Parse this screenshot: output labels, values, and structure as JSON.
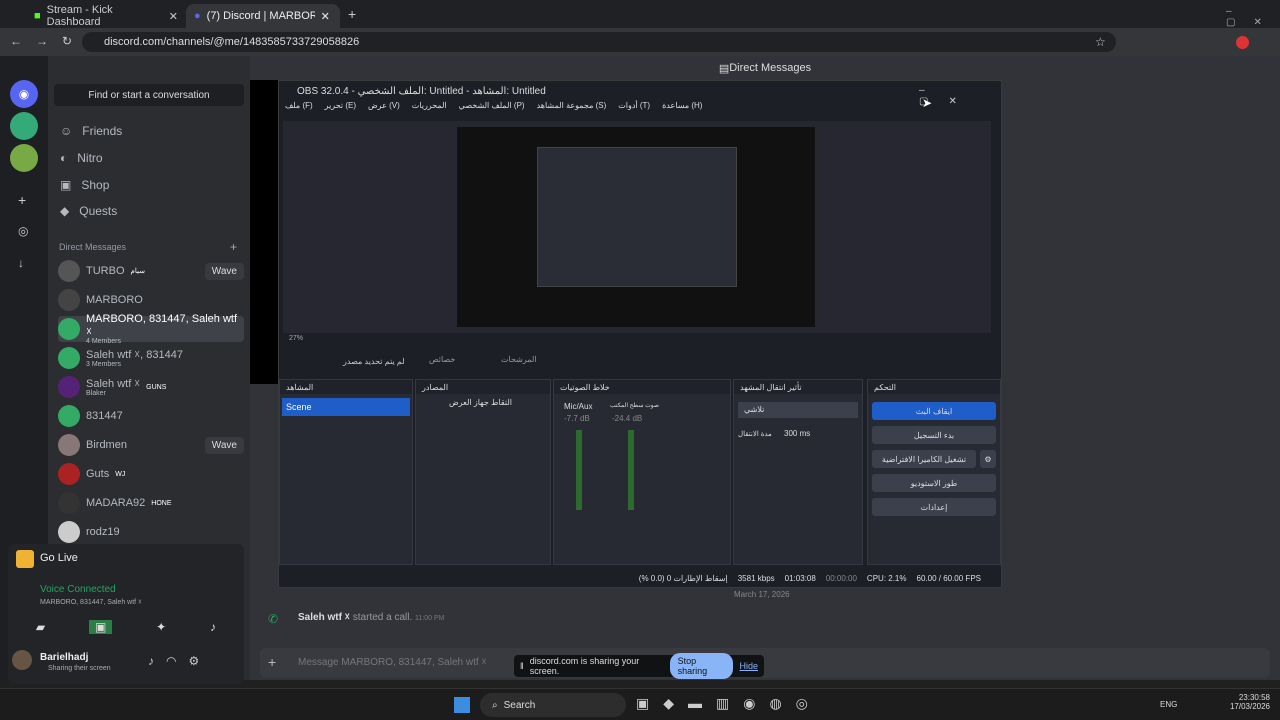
{
  "browser": {
    "tabs": [
      "Stream - Kick Dashboard",
      "(7) Discord | MARBORO, 831447, Saleh wtf"
    ],
    "url": "discord.com/channels/@me/1483585733729058826"
  },
  "discord": {
    "find": "Find or start a conversation",
    "nav": [
      "Friends",
      "Nitro",
      "Shop",
      "Quests"
    ],
    "dm_header": "Direct Messages",
    "dms": [
      {
        "name": "TURBO",
        "tag": "سيام",
        "wave": "Wave",
        "color": "#555"
      },
      {
        "name": "MARBORO",
        "color": "#444"
      },
      {
        "name": "MARBORO, 831447, Saleh wtf ☓",
        "sub": "4 Members",
        "color": "#3a6"
      },
      {
        "name": "Saleh wtf ☓, 831447",
        "sub": "3 Members",
        "color": "#3a6"
      },
      {
        "name": "Saleh wtf ☓",
        "tag": "GUNS",
        "sub": "Blaker",
        "color": "#527"
      },
      {
        "name": "831447",
        "color": "#3a6"
      },
      {
        "name": "Birdmen",
        "wave": "Wave",
        "color": "#877"
      },
      {
        "name": "Guts",
        "tag": "WJ",
        "color": "#a22"
      },
      {
        "name": "MADARA92",
        "tag": "HONE",
        "color": "#333"
      },
      {
        "name": "rodz19",
        "color": "#ccc"
      }
    ],
    "topbar": "Direct Messages",
    "golive": "Go Live",
    "voice": "Voice Connected",
    "voice_sub": "MARBORO, 831447, Saleh wtf ☓",
    "user": "Barielhadj",
    "user_status": "Sharing their screen",
    "date_sep": "March 17, 2026",
    "call_user": "Saleh wtf ☓",
    "call_text": "started a call.",
    "call_time": "11:00 PM",
    "placeholder": "Message MARBORO, 831447, Saleh wtf ☓",
    "share_text": "discord.com is sharing your screen.",
    "stop": "Stop sharing",
    "hide": "Hide"
  },
  "obs": {
    "title": "OBS 32.0.4 - الملف الشخصي: Untitled - المشاهد: Untitled",
    "menu": [
      "ملف (F)",
      "تحرير (E)",
      "عرض (V)",
      "المحرريات",
      "الملف الشخصي (P)",
      "مجموعة المشاهد (S)",
      "أدوات (T)",
      "مساعدة (H)"
    ],
    "zoom": "27%",
    "no_source": "لم يتم تحديد مصدر",
    "props": "خصائص",
    "filters": "المرشحات",
    "docks": {
      "scenes": "المشاهد",
      "sources": "المصادر",
      "mixer": "خلاط الصوتيات",
      "transitions": "تأثير انتقال المشهد",
      "controls": "التحكم"
    },
    "scene": "Scene",
    "source": "التقاط جهاز العرض",
    "mic": {
      "name": "Mic/Aux",
      "db": "-7.7 dB"
    },
    "desk": {
      "name": "صوت سطح المكتب",
      "db": "-24.4 dB"
    },
    "transition": "تلاشي",
    "duration_label": "مدة الانتقال",
    "duration": "300 ms",
    "controls": [
      "ايقاف البث",
      "بدء التسجيل",
      "تشغيل الكاميرا الافتراضية",
      "طور الاستوديو",
      "إعدادات"
    ],
    "status": {
      "dropped": "إسقاط الإطارات 0 (0.0 %)",
      "kbps": "3581 kbps",
      "time": "01:03:08",
      "rec": "00:00:00",
      "cpu": "CPU: 2.1%",
      "fps": "60.00 / 60.00 FPS"
    }
  },
  "taskbar": {
    "search": "Search",
    "lang": "ENG",
    "time": "23:30:58",
    "date": "17/03/2026"
  }
}
